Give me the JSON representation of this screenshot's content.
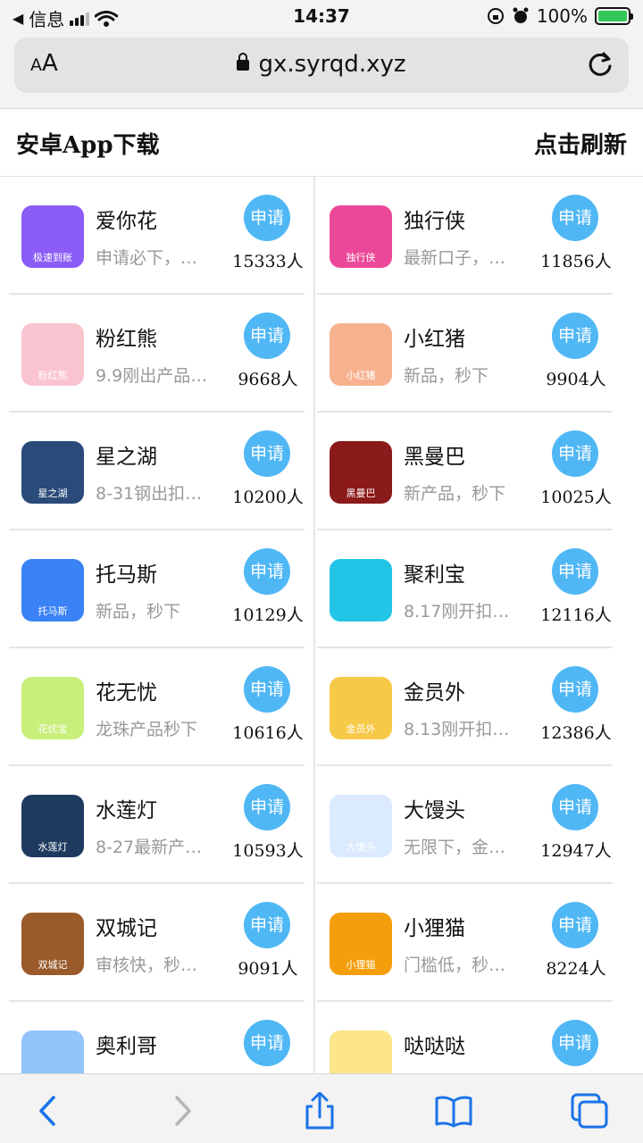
{
  "status_bar": {
    "back_app": "信息",
    "time": "14:37",
    "battery": "100%"
  },
  "browser": {
    "aa_small": "A",
    "aa_large": "A",
    "url": "gx.syrqd.xyz"
  },
  "header": {
    "title": "安卓App下载",
    "refresh": "点击刷新"
  },
  "apply_label": "申请",
  "apps": [
    {
      "name": "爱你花",
      "desc": "申请必下，…",
      "count": "15333人",
      "icon": "heart-icon",
      "icon_text": "极速到账",
      "icon_color": "#8b5cf6"
    },
    {
      "name": "独行侠",
      "desc": "最新口子，…",
      "count": "11856人",
      "icon": "hero-icon",
      "icon_text": "独行侠",
      "icon_color": "#ec4899"
    },
    {
      "name": "粉红熊",
      "desc": "9.9刚出产品 …",
      "count": "9668人",
      "icon": "bear-icon",
      "icon_text": "粉红熊",
      "icon_color": "#f9c4cf"
    },
    {
      "name": "小红猪",
      "desc": "新品，秒下",
      "count": "9904人",
      "icon": "pig-icon",
      "icon_text": "小红猪",
      "icon_color": "#f7b18f"
    },
    {
      "name": "星之湖",
      "desc": "8-31钢出扣…",
      "count": "10200人",
      "icon": "lake-icon",
      "icon_text": "星之湖",
      "icon_color": "#2a4a7a"
    },
    {
      "name": "黑曼巴",
      "desc": "新产品，秒下",
      "count": "10025人",
      "icon": "snake-icon",
      "icon_text": "黑曼巴",
      "icon_color": "#8b1a1a"
    },
    {
      "name": "托马斯",
      "desc": "新品，秒下",
      "count": "10129人",
      "icon": "train-icon",
      "icon_text": "托马斯",
      "icon_color": "#3b82f6"
    },
    {
      "name": "聚利宝",
      "desc": "8.17刚开扣…",
      "count": "12116人",
      "icon": "n-logo-icon",
      "icon_text": "",
      "icon_color": "#22c5e5"
    },
    {
      "name": "花无忧",
      "desc": "龙珠产品秒下",
      "count": "10616人",
      "icon": "smile-icon",
      "icon_text": "花优宝",
      "icon_color": "#c8ef7a"
    },
    {
      "name": "金员外",
      "desc": "8.13刚开扣…",
      "count": "12386人",
      "icon": "merchant-icon",
      "icon_text": "金员外",
      "icon_color": "#f7c948"
    },
    {
      "name": "水莲灯",
      "desc": "8-27最新产…",
      "count": "10593人",
      "icon": "lotus-icon",
      "icon_text": "水莲灯",
      "icon_color": "#1e3a5f"
    },
    {
      "name": "大馒头",
      "desc": "无限下，金…",
      "count": "12947人",
      "icon": "bun-icon",
      "icon_text": "大馒头",
      "icon_color": "#dbeafe"
    },
    {
      "name": "双城记",
      "desc": "审核快，秒…",
      "count": "9091人",
      "icon": "soldiers-icon",
      "icon_text": "双城记",
      "icon_color": "#9a5a2a"
    },
    {
      "name": "小狸猫",
      "desc": "门槛低，秒…",
      "count": "8224人",
      "icon": "raccoon-icon",
      "icon_text": "小狸猫",
      "icon_color": "#f59e0b"
    },
    {
      "name": "奥利哥",
      "desc": "",
      "count": "",
      "icon": "face-icon",
      "icon_text": "",
      "icon_color": "#93c5fd"
    },
    {
      "name": "哒哒哒",
      "desc": "",
      "count": "",
      "icon": "kid-icon",
      "icon_text": "",
      "icon_color": "#fde68a"
    }
  ]
}
